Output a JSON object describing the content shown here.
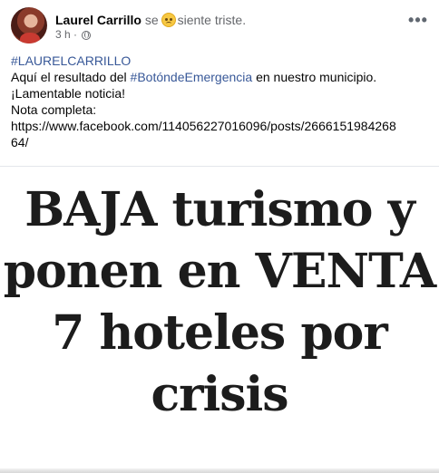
{
  "post": {
    "author": "Laurel Carrillo",
    "feeling_prefix": "se",
    "feeling_emoji": "sad-face-icon",
    "feeling_text": "siente triste.",
    "time": "3 h",
    "separator": "·",
    "audience_icon": "globe-icon",
    "menu": "•••"
  },
  "body": {
    "hashtag_main": "#LAURELCARRILLO",
    "line2_before": "Aquí el resultado del ",
    "line2_hashtag": "#BotóndeEmergencia",
    "line2_after": " en nuestro municipio.",
    "line3": "¡Lamentable noticia!",
    "line4": "Nota completa:",
    "url_line1": "https://www.facebook.com/114056227016096/posts/2666151984268",
    "url_line2": "64/"
  },
  "image": {
    "headline_lines": [
      "BAJA turismo y",
      "ponen en VENTA",
      "7 hoteles por",
      "crisis"
    ]
  },
  "colors": {
    "link": "#385898",
    "secondary_text": "#65676b",
    "primary_text": "#050505"
  }
}
